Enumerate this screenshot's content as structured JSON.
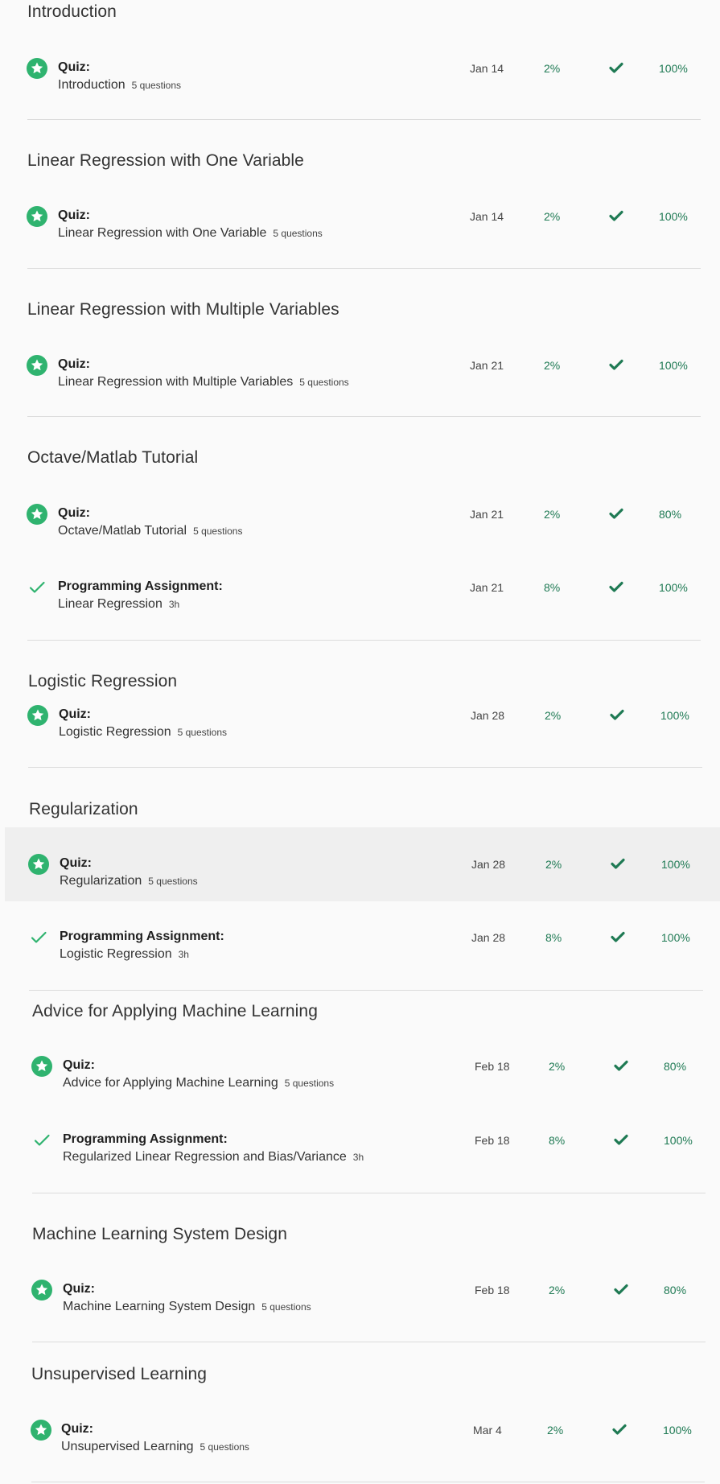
{
  "colors": {
    "accent_green": "#2fb36f",
    "text_green": "#1f7a54",
    "check_green": "#1f7a54",
    "divider": "#dcdcdc",
    "hover_bg": "#efefef"
  },
  "sections": [
    {
      "title": "Introduction",
      "items": [
        {
          "icon": "star-badge-icon",
          "type": "Quiz:",
          "name": "Introduction",
          "meta": "5 questions",
          "due": "Jan 14",
          "weight": "2%",
          "status_icon": "check-icon",
          "grade": "100%"
        }
      ]
    },
    {
      "title": "Linear Regression with One Variable",
      "items": [
        {
          "icon": "star-badge-icon",
          "type": "Quiz:",
          "name": "Linear Regression with One Variable",
          "meta": "5 questions",
          "due": "Jan 14",
          "weight": "2%",
          "status_icon": "check-icon",
          "grade": "100%"
        }
      ]
    },
    {
      "title": "Linear Regression with Multiple Variables",
      "items": [
        {
          "icon": "star-badge-icon",
          "type": "Quiz:",
          "name": "Linear Regression with Multiple Variables",
          "meta": "5 questions",
          "due": "Jan 21",
          "weight": "2%",
          "status_icon": "check-icon",
          "grade": "100%"
        }
      ]
    },
    {
      "title": "Octave/Matlab Tutorial",
      "items": [
        {
          "icon": "star-badge-icon",
          "type": "Quiz:",
          "name": "Octave/Matlab Tutorial",
          "meta": "5 questions",
          "due": "Jan 21",
          "weight": "2%",
          "status_icon": "check-icon",
          "grade": "80%"
        },
        {
          "icon": "checkmark-icon",
          "type": "Programming Assignment:",
          "name": "Linear Regression",
          "meta": "3h",
          "due": "Jan 21",
          "weight": "8%",
          "status_icon": "check-icon",
          "grade": "100%"
        }
      ]
    },
    {
      "title": "Logistic Regression",
      "items": [
        {
          "icon": "star-badge-icon",
          "type": "Quiz:",
          "name": "Logistic Regression",
          "meta": "5 questions",
          "due": "Jan 28",
          "weight": "2%",
          "status_icon": "check-icon",
          "grade": "100%"
        }
      ]
    },
    {
      "title": "Regularization",
      "items": [
        {
          "icon": "star-badge-icon",
          "type": "Quiz:",
          "name": "Regularization",
          "meta": "5 questions",
          "due": "Jan 28",
          "weight": "2%",
          "status_icon": "check-icon",
          "grade": "100%"
        },
        {
          "icon": "checkmark-icon",
          "type": "Programming Assignment:",
          "name": "Logistic Regression",
          "meta": "3h",
          "due": "Jan 28",
          "weight": "8%",
          "status_icon": "check-icon",
          "grade": "100%"
        }
      ]
    },
    {
      "title": "Advice for Applying Machine Learning",
      "items": [
        {
          "icon": "star-badge-icon",
          "type": "Quiz:",
          "name": "Advice for Applying Machine Learning",
          "meta": "5 questions",
          "due": "Feb 18",
          "weight": "2%",
          "status_icon": "check-icon",
          "grade": "80%"
        },
        {
          "icon": "checkmark-icon",
          "type": "Programming Assignment:",
          "name": "Regularized Linear Regression and Bias/Variance",
          "meta": "3h",
          "due": "Feb 18",
          "weight": "8%",
          "status_icon": "check-icon",
          "grade": "100%"
        }
      ]
    },
    {
      "title": "Machine Learning System Design",
      "items": [
        {
          "icon": "star-badge-icon",
          "type": "Quiz:",
          "name": "Machine Learning System Design",
          "meta": "5 questions",
          "due": "Feb 18",
          "weight": "2%",
          "status_icon": "check-icon",
          "grade": "80%"
        }
      ]
    },
    {
      "title": "Unsupervised Learning",
      "items": [
        {
          "icon": "star-badge-icon",
          "type": "Quiz:",
          "name": "Unsupervised Learning",
          "meta": "5 questions",
          "due": "Mar 4",
          "weight": "2%",
          "status_icon": "check-icon",
          "grade": "100%"
        }
      ]
    }
  ]
}
